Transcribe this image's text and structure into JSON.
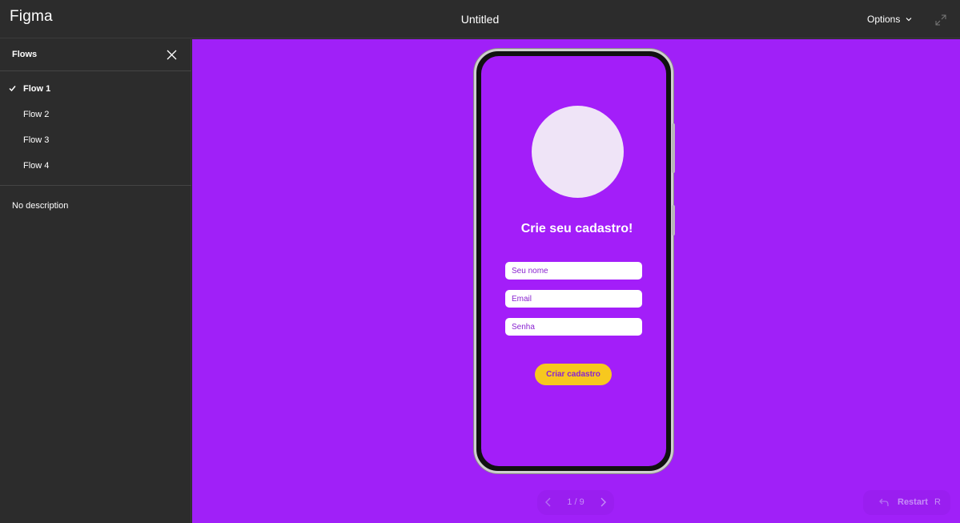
{
  "app": {
    "name": "Figma",
    "document_title": "Untitled"
  },
  "header": {
    "options_label": "Options",
    "options_icon": "chevron-down-icon",
    "expand_icon": "expand-icon"
  },
  "sidebar": {
    "title": "Flows",
    "close_icon": "close-icon",
    "flows": [
      {
        "label": "Flow 1",
        "active": true
      },
      {
        "label": "Flow 2",
        "active": false
      },
      {
        "label": "Flow 3",
        "active": false
      },
      {
        "label": "Flow 4",
        "active": false
      }
    ],
    "description": "No description"
  },
  "prototype": {
    "heading": "Crie seu cadastro!",
    "fields": [
      {
        "placeholder": "Seu nome",
        "value": ""
      },
      {
        "placeholder": "Email",
        "value": ""
      },
      {
        "placeholder": "Senha",
        "value": ""
      }
    ],
    "submit_label": "Criar cadastro"
  },
  "pager": {
    "count": "1 / 9"
  },
  "restart": {
    "label": "Restart",
    "shortcut": "R"
  },
  "colors": {
    "chrome": "#2c2c2c",
    "canvas": "#a020f8",
    "screen": "#a31ef9",
    "avatar": "#efe4f7",
    "button": "#f7c81e",
    "field_text": "#8a24d0"
  }
}
